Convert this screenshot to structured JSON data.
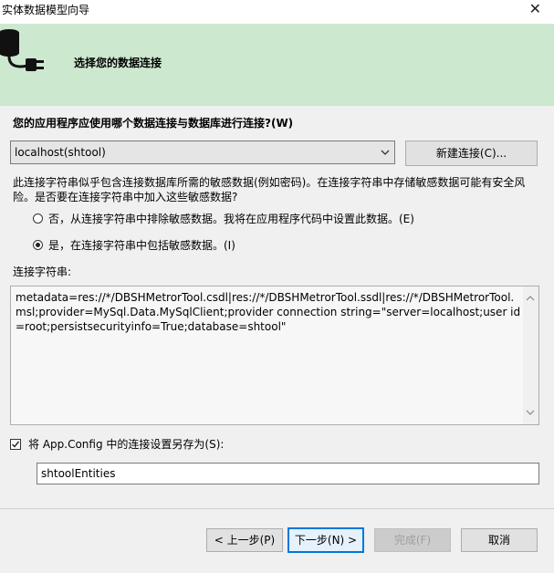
{
  "window": {
    "title": "实体数据模型向导",
    "close_glyph": "✕"
  },
  "banner": {
    "title": "选择您的数据连接",
    "icon": "database-plug-icon"
  },
  "question": "您的应用程序应使用哪个数据连接与数据库进行连接?(W)",
  "connection": {
    "selected": "localhost(shtool)",
    "new_button": "新建连接(C)..."
  },
  "sensitive": {
    "description": "此连接字符串似乎包含连接数据库所需的敏感数据(例如密码)。在连接字符串中存储敏感数据可能有安全风险。是否要在连接字符串中加入这些敏感数据?",
    "option_exclude": "否，从连接字符串中排除敏感数据。我将在应用程序代码中设置此数据。(E)",
    "option_include": "是，在连接字符串中包括敏感数据。(I)",
    "selected": "include"
  },
  "connection_string": {
    "label": "连接字符串:",
    "value": "metadata=res://*/DBSHMetrorTool.csdl|res://*/DBSHMetrorTool.ssdl|res://*/DBSHMetrorTool.msl;provider=MySql.Data.MySqlClient;provider connection string=\"server=localhost;user id=root;persistsecurityinfo=True;database=shtool\""
  },
  "save_config": {
    "label": "将 App.Config 中的连接设置另存为(S):",
    "checked": true,
    "value": "shtoolEntities"
  },
  "buttons": {
    "prev": "< 上一步(P)",
    "next": "下一步(N) >",
    "finish": "完成(F)",
    "cancel": "取消"
  }
}
